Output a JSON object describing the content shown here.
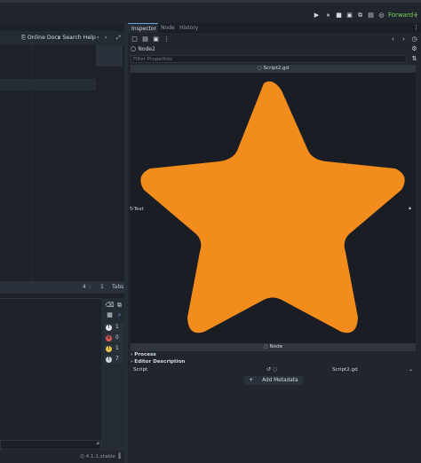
{
  "toolbar": {
    "play_icon": "▶",
    "pause_icon": "⏸",
    "stop_icon": "■",
    "renderer": "Forward+"
  },
  "script_editor": {
    "online_docs": "Online Docs",
    "search_help": "Search Help",
    "line": "4",
    "separator": ":",
    "column": "1",
    "indent_mode": "Tabs"
  },
  "debugger": {
    "counts": [
      {
        "name": "info",
        "value": "1",
        "color": "#e0e4ea",
        "glyph": "!"
      },
      {
        "name": "errors",
        "value": "0",
        "color": "#e05858",
        "glyph": "x"
      },
      {
        "name": "warnings",
        "value": "1",
        "color": "#e7c84a",
        "glyph": "!"
      },
      {
        "name": "messages",
        "value": "7",
        "color": "#cdd3dc",
        "glyph": "!"
      }
    ],
    "version": "4.1.1.stable"
  },
  "inspector": {
    "tabs": [
      "Inspector",
      "Node",
      "History"
    ],
    "object_name": "Node2",
    "filter_placeholder": "Filter Properties",
    "script_header": "Script2.gd",
    "preview_left_label": "Test",
    "node_header": "Node",
    "sections": [
      "Process",
      "Editor Description"
    ],
    "script_label": "Script",
    "script_value": "Script2.gd",
    "add_metadata": "Add Metadata",
    "star_color": "#f28c1c"
  }
}
